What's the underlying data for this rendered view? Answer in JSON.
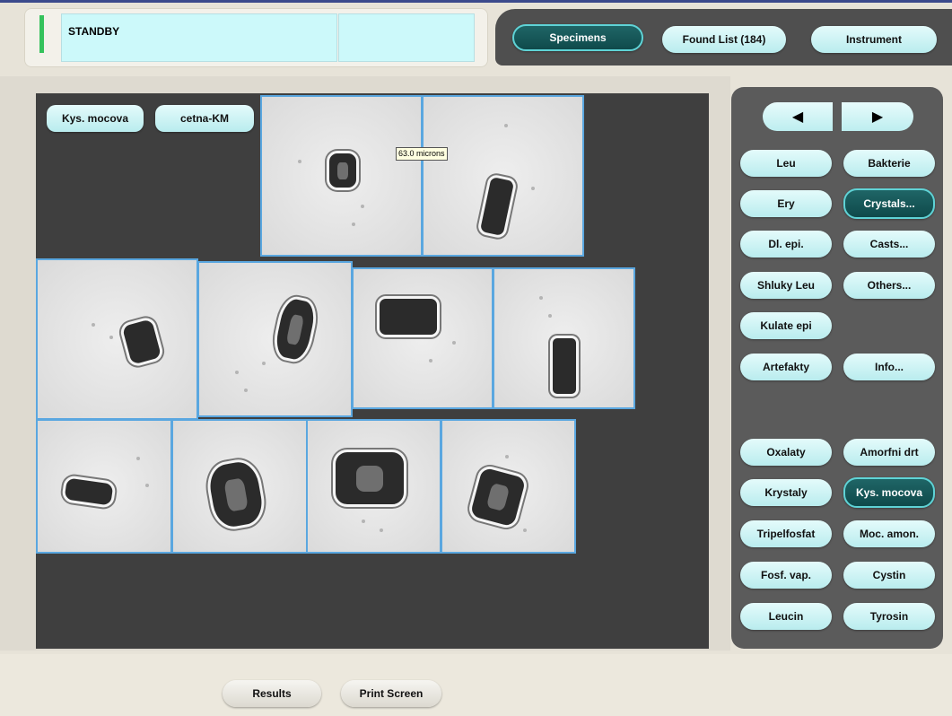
{
  "status": {
    "text": "STANDBY"
  },
  "nav": {
    "specimens": "Specimens",
    "found_list": "Found List (184)",
    "instrument": "Instrument"
  },
  "image_header": {
    "category": "Kys. mocova",
    "subcategory": "cetna-KM"
  },
  "measure_label": "63.0 microns",
  "arrows": {
    "prev": "◀",
    "next": "▶"
  },
  "class_buttons": {
    "leu": "Leu",
    "bakterie": "Bakterie",
    "ery": "Ery",
    "crystals": "Crystals...",
    "dl_epi": "Dl. epi.",
    "casts": "Casts...",
    "shluky_leu": "Shluky Leu",
    "others": "Others...",
    "kulate_epi": "Kulate epi",
    "artefakty": "Artefakty",
    "info": "Info..."
  },
  "crystal_buttons": {
    "oxalaty": "Oxalaty",
    "amorfni": "Amorfni drt",
    "krystaly": "Krystaly",
    "kys_mocova": "Kys. mocova",
    "tripelfosfat": "Tripelfosfat",
    "moc_amon": "Moc. amon.",
    "fosf_vap": "Fosf. vap.",
    "cystin": "Cystin",
    "leucin": "Leucin",
    "tyrosin": "Tyrosin"
  },
  "bottom": {
    "results": "Results",
    "print_screen": "Print Screen"
  },
  "colors": {
    "selected": "#0f4a4b",
    "button": "#c6f0f1",
    "panel": "#5b5b5b",
    "image_bg": "#3f3f3f"
  }
}
